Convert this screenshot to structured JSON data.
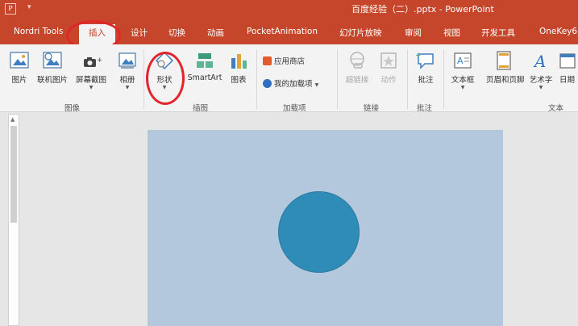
{
  "window": {
    "app_icon": "P",
    "title": "百度经验（二）.pptx - PowerPoint"
  },
  "tabs": [
    {
      "label": "Nordri Tools"
    },
    {
      "label": "插入",
      "active": true
    },
    {
      "label": "设计"
    },
    {
      "label": "切换"
    },
    {
      "label": "动画"
    },
    {
      "label": "PocketAnimation"
    },
    {
      "label": "幻灯片放映"
    },
    {
      "label": "审阅"
    },
    {
      "label": "视图"
    },
    {
      "label": "开发工具"
    },
    {
      "label": "OneKey6"
    }
  ],
  "ribbon": {
    "images_group": {
      "label": "图像",
      "buttons": [
        {
          "label": "图片",
          "icon": "picture-icon"
        },
        {
          "label": "联机图片",
          "icon": "online-picture-icon"
        },
        {
          "label": "屏幕截图",
          "icon": "screenshot-icon"
        },
        {
          "label": "相册",
          "icon": "photo-album-icon"
        }
      ]
    },
    "illustrations_group": {
      "label": "插图",
      "buttons": [
        {
          "label": "形状",
          "icon": "shapes-icon"
        },
        {
          "label": "SmartArt",
          "icon": "smartart-icon"
        },
        {
          "label": "图表",
          "icon": "chart-icon"
        }
      ]
    },
    "addins_group": {
      "label": "加载项",
      "store": "应用商店",
      "my_addins": "我的加载项"
    },
    "links_group": {
      "label": "链接",
      "buttons": [
        {
          "label": "超链接",
          "icon": "hyperlink-icon"
        },
        {
          "label": "动作",
          "icon": "action-icon"
        }
      ]
    },
    "comments_group": {
      "label": "批注",
      "buttons": [
        {
          "label": "批注",
          "icon": "comment-icon"
        }
      ]
    },
    "text_group": {
      "label": "文本",
      "buttons": [
        {
          "label": "文本框",
          "icon": "textbox-icon"
        },
        {
          "label": "页眉和页脚",
          "icon": "header-footer-icon"
        },
        {
          "label": "艺术字",
          "icon": "wordart-icon"
        },
        {
          "label": "日期",
          "icon": "date-time-icon"
        }
      ]
    }
  },
  "colors": {
    "accent": "#c5462a",
    "slide_background": "#b3c8dc",
    "circle_fill": "#2e8cb7",
    "annotation": "#e3242b"
  }
}
